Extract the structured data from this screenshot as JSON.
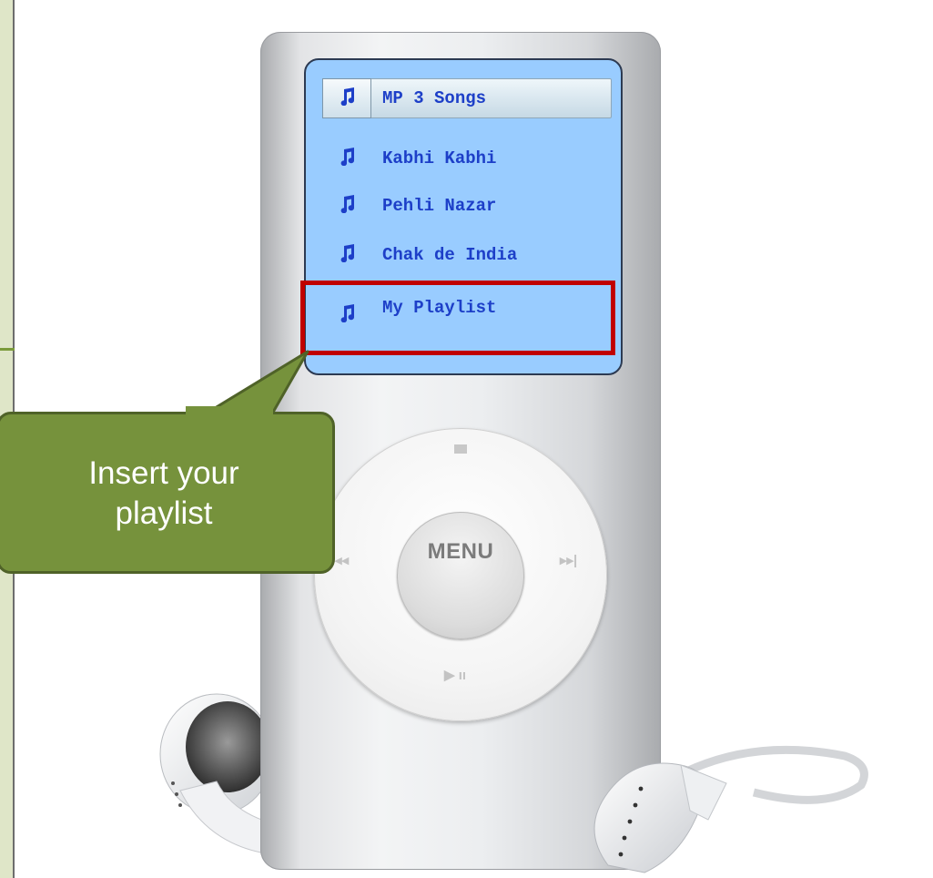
{
  "player": {
    "menu_items": [
      {
        "label": "MP 3 Songs",
        "selected": true
      },
      {
        "label": "Kabhi Kabhi",
        "selected": false
      },
      {
        "label": "Pehli Nazar",
        "selected": false
      },
      {
        "label": "Chak de India",
        "selected": false
      },
      {
        "label": "My Playlist",
        "selected": false,
        "highlighted": true
      }
    ],
    "center_button_label": "MENU",
    "wheel_icons": {
      "top": "menu-indicator-icon",
      "left": "previous-track-icon",
      "right": "next-track-icon",
      "bottom": "play-pause-icon"
    },
    "screen_color": "#99ccff",
    "text_color": "#1d3fc8",
    "highlight_color": "#c00000"
  },
  "callout": {
    "text": "Insert your\nplaylist",
    "fill_color": "#76923c",
    "border_color": "#4f6228"
  }
}
